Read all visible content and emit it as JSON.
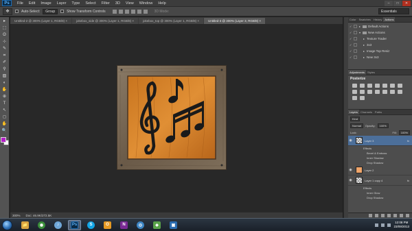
{
  "app": {
    "logo": "Ps"
  },
  "menu": [
    "File",
    "Edit",
    "Image",
    "Layer",
    "Type",
    "Select",
    "Filter",
    "3D",
    "View",
    "Window",
    "Help"
  ],
  "window_controls": [
    "–",
    "□",
    "✕"
  ],
  "options": {
    "tool_glyph": "✥",
    "auto_select_label": "Auto-Select:",
    "auto_select_value": "Group",
    "show_transform_label": "Show Transform Controls",
    "mode_3d_label": "3D Mode:",
    "workspace": "Essentials"
  },
  "tools": [
    "▸",
    "⬚",
    "ʘ",
    "⊹",
    "✎",
    "⌗",
    "✐",
    "⚲",
    "▨",
    "◐",
    "✋",
    "⊕",
    "T",
    "↖",
    "◻",
    "✋",
    "🔍"
  ],
  "doc_tabs": [
    {
      "label": "Untitled-2 @ 300% (Layer 1, RGB/8) ×",
      "active": false
    },
    {
      "label": "jokebox_side @ 300% (Layer 1, RGB/8) ×",
      "active": false
    },
    {
      "label": "jokebox_top @ 300% (Layer 1, RGB/8) ×",
      "active": false
    },
    {
      "label": "Untitled-3 @ 300% (Layer 3, RGB/8) ×",
      "active": true
    }
  ],
  "status": {
    "zoom": "300%",
    "doc": "Doc: 46.9K/272.5K"
  },
  "panel_tabs_top": [
    {
      "label": "Color",
      "active": false
    },
    {
      "label": "Swatches",
      "active": false
    },
    {
      "label": "History",
      "active": false
    },
    {
      "label": "Actions",
      "active": true
    }
  ],
  "actions": [
    {
      "label": "Default Actions",
      "level": 0,
      "folder": true
    },
    {
      "label": "New Actions",
      "level": 0,
      "folder": true
    },
    {
      "label": "Texture Trader",
      "level": 1,
      "folder": false
    },
    {
      "label": "3x3",
      "level": 1,
      "folder": false
    },
    {
      "label": "Image Top Resiz",
      "level": 1,
      "folder": false
    },
    {
      "label": "New 3x3",
      "level": 1,
      "folder": false
    }
  ],
  "adj_tabs": [
    {
      "label": "Adjustments",
      "active": true
    },
    {
      "label": "Styles",
      "active": false
    }
  ],
  "adj_title": "Posterize",
  "layer_tabs": [
    {
      "label": "Layers",
      "active": true
    },
    {
      "label": "Channels",
      "active": false
    },
    {
      "label": "Paths",
      "active": false
    }
  ],
  "layers_ctrl": {
    "filter_kind": "Kind",
    "blend_mode": "Normal",
    "opacity_label": "Opacity:",
    "opacity_value": "100%",
    "lock_label": "Lock:",
    "fill_label": "Fill:",
    "fill_value": "100%"
  },
  "layers": [
    {
      "name": "Layer 3",
      "thumb": "checker",
      "fx": "fx",
      "selected": true,
      "effects_label": "Effects",
      "effects": [
        "Bevel & Emboss",
        "Inner Shadow",
        "Drop Shadow"
      ]
    },
    {
      "name": "Layer 2",
      "thumb": "orange",
      "fx": "",
      "selected": false,
      "effects_label": "",
      "effects": []
    },
    {
      "name": "Layer 1 copy 4",
      "thumb": "checker",
      "fx": "fx",
      "selected": false,
      "effects_label": "Effects",
      "effects": [
        "Inner Glow",
        "Drop Shadow"
      ]
    }
  ],
  "taskbar": {
    "apps": [
      {
        "name": "explorer",
        "glyph": "📁",
        "color": "#d9a441"
      },
      {
        "name": "chrome",
        "glyph": "◉",
        "color": "#3a8f3a"
      },
      {
        "name": "itunes",
        "glyph": "♪",
        "color": "#6fa7d8"
      },
      {
        "name": "photoshop",
        "glyph": "Ps",
        "color": "#0a2a45",
        "active": true
      },
      {
        "name": "skype",
        "glyph": "S",
        "color": "#12a5e6"
      },
      {
        "name": "outlook",
        "glyph": "O",
        "color": "#e69a24"
      },
      {
        "name": "onenote",
        "glyph": "N",
        "color": "#7a2a94"
      },
      {
        "name": "media",
        "glyph": "◎",
        "color": "#3d86c5"
      },
      {
        "name": "app9",
        "glyph": "◆",
        "color": "#5aa34a"
      },
      {
        "name": "app10",
        "glyph": "▣",
        "color": "#2b6cb0"
      }
    ],
    "time": "12:08 PM",
    "date": "23/09/2013"
  },
  "colors": {
    "foreground": "#b31ec6",
    "background": "#ffffff",
    "selection": "#4c6f9a"
  }
}
